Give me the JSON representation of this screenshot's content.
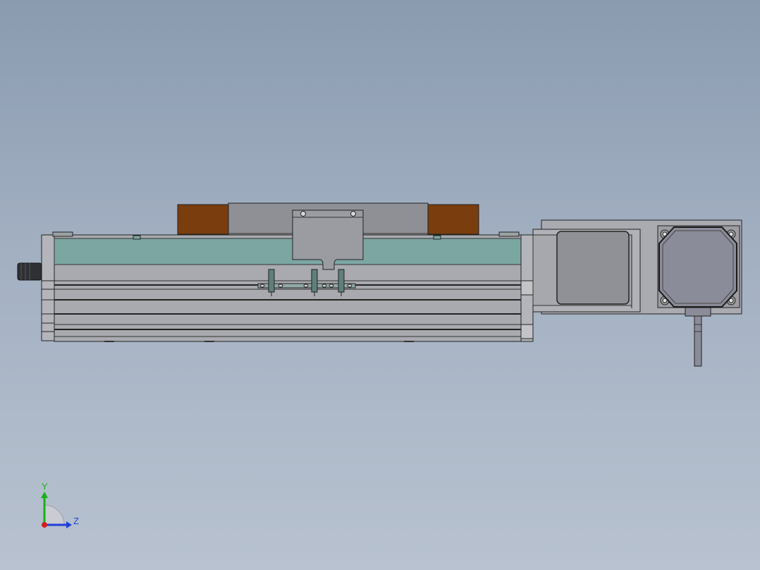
{
  "triad": {
    "y_label": "Y",
    "z_label": "Z",
    "y_color": "#17b117",
    "z_color": "#1f3fd8",
    "x_color": "#d21f1f"
  },
  "colors": {
    "background_top": "#8a9bb0",
    "background_bottom": "#b8c2d0",
    "aluminum": "#a9abb0",
    "cover_teal": "#7da7a3",
    "end_block": "#7b3a0b",
    "motor_body": "#8b8c99",
    "edge": "#1a1a1a"
  }
}
